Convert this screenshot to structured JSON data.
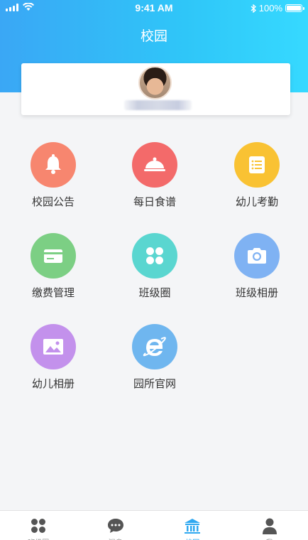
{
  "status_bar": {
    "time": "9:41 AM",
    "battery": "100%",
    "battery_level": 1.0
  },
  "header": {
    "title": "校园"
  },
  "grid": [
    {
      "label": "校园公告",
      "icon": "bell-icon",
      "color": "#f7866f"
    },
    {
      "label": "每日食谱",
      "icon": "dish-cover-icon",
      "color": "#f36a6a"
    },
    {
      "label": "幼儿考勤",
      "icon": "checklist-icon",
      "color": "#f9c233"
    },
    {
      "label": "缴费管理",
      "icon": "card-icon",
      "color": "#7ccf84"
    },
    {
      "label": "班级圈",
      "icon": "four-petal-icon",
      "color": "#5ad6d0"
    },
    {
      "label": "班级相册",
      "icon": "camera-icon",
      "color": "#7fb2f3"
    },
    {
      "label": "幼儿相册",
      "icon": "picture-icon",
      "color": "#c391ec"
    },
    {
      "label": "园所官网",
      "icon": "browser-e-icon",
      "color": "#6fb6ef"
    }
  ],
  "tabbar": [
    {
      "label": "班级圈",
      "icon": "four-petal-icon",
      "active": false
    },
    {
      "label": "消息",
      "icon": "chat-bubble-icon",
      "active": false
    },
    {
      "label": "校园",
      "icon": "school-building-icon",
      "active": true
    },
    {
      "label": "我",
      "icon": "person-icon",
      "active": false
    }
  ],
  "colors": {
    "accent": "#2fa8f0",
    "header_start": "#3aa7f5",
    "header_end": "#36d9ff"
  }
}
